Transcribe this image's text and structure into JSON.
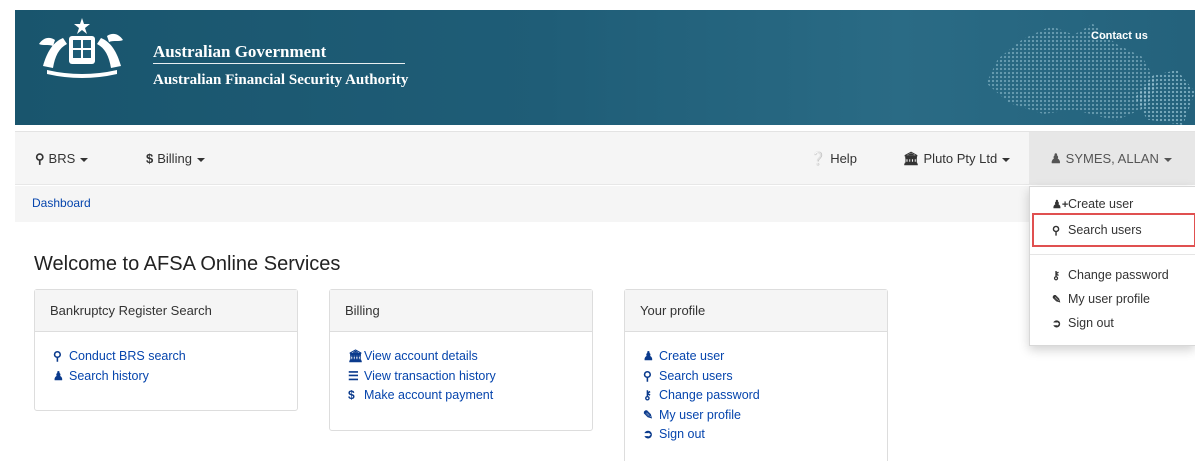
{
  "header": {
    "gov_title": "Australian Government",
    "agency_title": "Australian Financial Security Authority",
    "contact_label": "Contact us"
  },
  "navbar": {
    "brs_label": "BRS",
    "billing_label": "Billing",
    "help_label": "Help",
    "org_label": "Pluto Pty Ltd",
    "user_label": "SYMES, ALLAN"
  },
  "breadcrumb": {
    "dashboard_label": "Dashboard"
  },
  "page": {
    "title": "Welcome to AFSA Online Services"
  },
  "panels": {
    "brs": {
      "title": "Bankruptcy Register Search",
      "links": [
        {
          "label": "Conduct BRS search",
          "icon": "search-icon"
        },
        {
          "label": "Search history",
          "icon": "user-icon"
        }
      ]
    },
    "billing": {
      "title": "Billing",
      "links": [
        {
          "label": "View account details",
          "icon": "bank-icon"
        },
        {
          "label": "View transaction history",
          "icon": "list-icon"
        },
        {
          "label": "Make account payment",
          "icon": "dollar-icon"
        }
      ]
    },
    "profile": {
      "title": "Your profile",
      "links": [
        {
          "label": "Create user",
          "icon": "add-user-icon"
        },
        {
          "label": "Search users",
          "icon": "search-icon"
        },
        {
          "label": "Change password",
          "icon": "key-icon"
        },
        {
          "label": "My user profile",
          "icon": "edit-icon"
        },
        {
          "label": "Sign out",
          "icon": "sign-out-icon"
        }
      ]
    }
  },
  "user_menu": {
    "items": [
      {
        "label": "Create user",
        "icon": "add-user-icon"
      },
      {
        "label": "Search users",
        "icon": "search-icon",
        "highlighted": true
      },
      {
        "label": "Change password",
        "icon": "key-icon"
      },
      {
        "label": "My user profile",
        "icon": "edit-icon"
      },
      {
        "label": "Sign out",
        "icon": "sign-out-icon"
      }
    ]
  },
  "colors": {
    "banner": "#1f5d77",
    "link": "#0645ad",
    "highlight_border": "#e05050"
  }
}
